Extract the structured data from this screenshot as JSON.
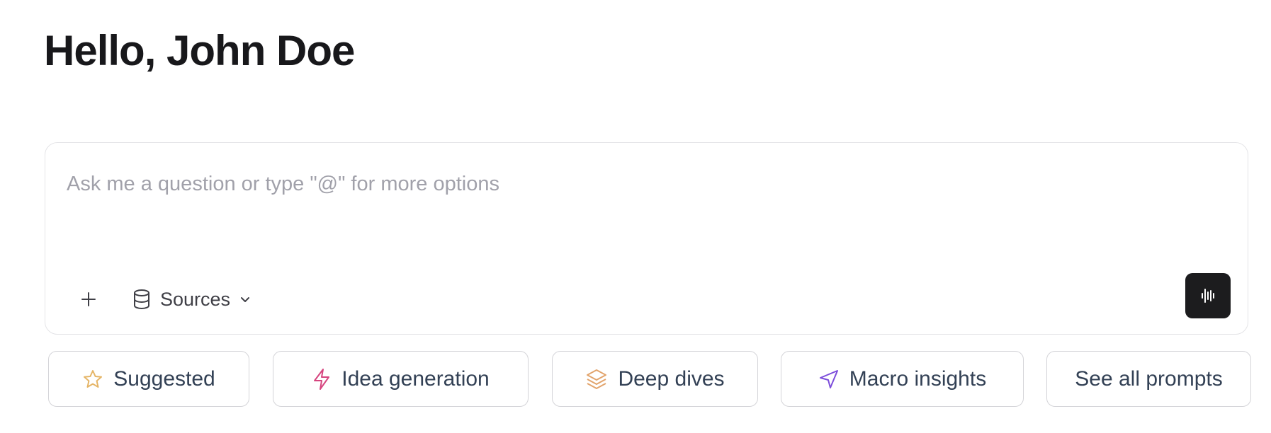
{
  "greeting": "Hello, John Doe",
  "composer": {
    "placeholder": "Ask me a question or type \"@\" for more options",
    "value": "",
    "add_icon": "plus-icon",
    "sources": {
      "icon": "database-icon",
      "label": "Sources",
      "chevron_icon": "chevron-down-icon"
    },
    "voice_button": {
      "icon": "audio-waveform-icon",
      "color": "#1c1c1e"
    }
  },
  "prompt_chips": [
    {
      "label": "Suggested",
      "icon": "star-icon",
      "icon_color": "#e5b567"
    },
    {
      "label": "Idea generation",
      "icon": "lightning-icon",
      "icon_color": "#d6457f"
    },
    {
      "label": "Deep dives",
      "icon": "layers-icon",
      "icon_color": "#e2a46c"
    },
    {
      "label": "Macro insights",
      "icon": "navigation-arrow-icon",
      "icon_color": "#7c4ddb"
    },
    {
      "label": "See all prompts"
    }
  ],
  "colors": {
    "text_primary": "#18181b",
    "chip_text": "#334155",
    "border": "#d4d4d8"
  }
}
